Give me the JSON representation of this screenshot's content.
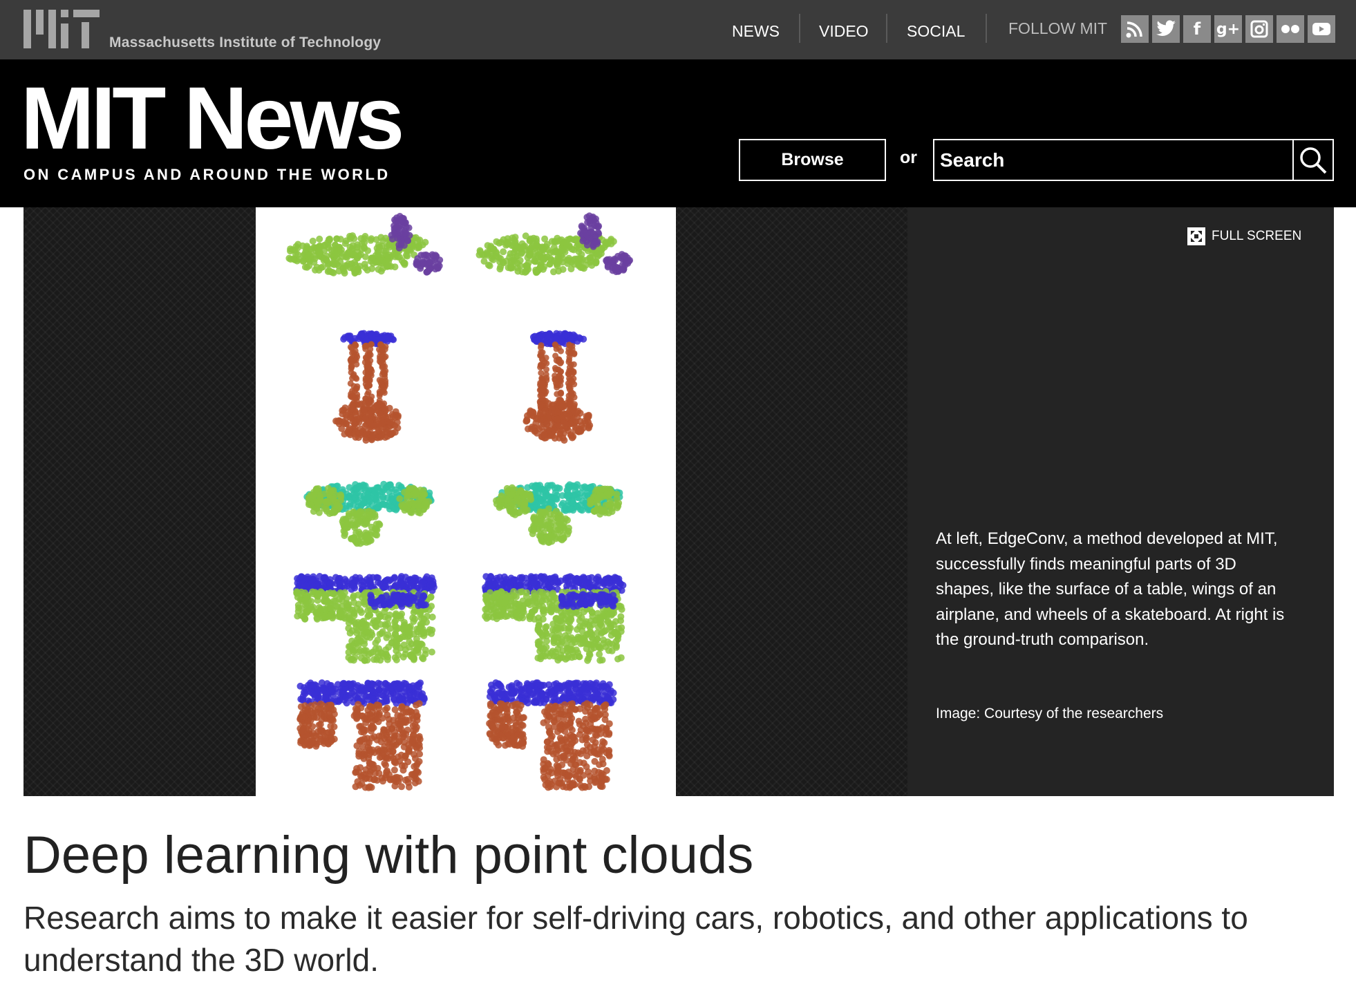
{
  "header": {
    "org_name": "Massachusetts Institute of Technology",
    "nav": [
      "NEWS",
      "VIDEO",
      "SOCIAL"
    ],
    "follow_label": "FOLLOW MIT",
    "social_icons": [
      "rss-icon",
      "twitter-icon",
      "facebook-icon",
      "google-plus-icon",
      "instagram-icon",
      "flickr-icon",
      "youtube-icon"
    ]
  },
  "masthead": {
    "title": "MIT News",
    "tagline": "ON CAMPUS AND AROUND THE WORLD",
    "browse_label": "Browse",
    "or_label": "or",
    "search_placeholder": "Search"
  },
  "slideshow": {
    "fullscreen_label": "FULL SCREEN",
    "caption": "At left, EdgeConv, a method developed at MIT, successfully finds meaningful parts of 3D shapes, like the surface of a table, wings of an airplane, and wheels of a skateboard. At right is the ground-truth comparison.",
    "credit": "Image: Courtesy of the researchers"
  },
  "article": {
    "headline": "Deep learning with point clouds",
    "subheadline": "Research aims to make it easier for self-driving cars, robotics, and other applications to understand the 3D world."
  },
  "colors": {
    "utility_bar": "#3b3b3b",
    "masthead": "#000000",
    "caption_panel": "#242424",
    "green_points": "#8cc63f",
    "purple_points": "#6a3fa0",
    "blue_points": "#3a2fd6",
    "rust_points": "#b5532e",
    "teal_points": "#2ec4a6"
  }
}
